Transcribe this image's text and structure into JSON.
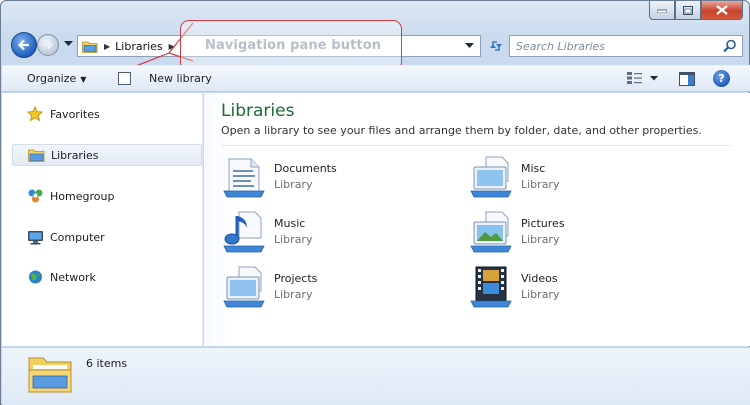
{
  "address": {
    "crumbs": [
      "Libraries"
    ]
  },
  "search": {
    "placeholder": "Search Libraries"
  },
  "callout": {
    "text": "Navigation pane button",
    "color": "#d63b46"
  },
  "toolbar": {
    "organize_label": "Organize",
    "new_library_label": "New library"
  },
  "sidebar": {
    "items": [
      {
        "label": "Favorites",
        "icon": "star-icon",
        "selected": false
      },
      {
        "label": "Libraries",
        "icon": "libraries-folder-icon",
        "selected": true
      },
      {
        "label": "Homegroup",
        "icon": "homegroup-icon",
        "selected": false
      },
      {
        "label": "Computer",
        "icon": "computer-icon",
        "selected": false
      },
      {
        "label": "Network",
        "icon": "network-icon",
        "selected": false
      }
    ]
  },
  "main": {
    "title": "Libraries",
    "description": "Open a library to see your files and arrange them by folder, date, and other properties.",
    "libraries": [
      {
        "name": "Documents",
        "type": "Library",
        "icon": "documents-library-icon"
      },
      {
        "name": "Misc",
        "type": "Library",
        "icon": "monitor-library-icon"
      },
      {
        "name": "Music",
        "type": "Library",
        "icon": "music-library-icon"
      },
      {
        "name": "Pictures",
        "type": "Library",
        "icon": "pictures-library-icon"
      },
      {
        "name": "Projects",
        "type": "Library",
        "icon": "monitor-library-icon"
      },
      {
        "name": "Videos",
        "type": "Library",
        "icon": "videos-library-icon"
      }
    ]
  },
  "details": {
    "count_text": "6 items"
  },
  "colors": {
    "title_green": "#1e6a35",
    "accent_blue": "#1f5fbd"
  }
}
